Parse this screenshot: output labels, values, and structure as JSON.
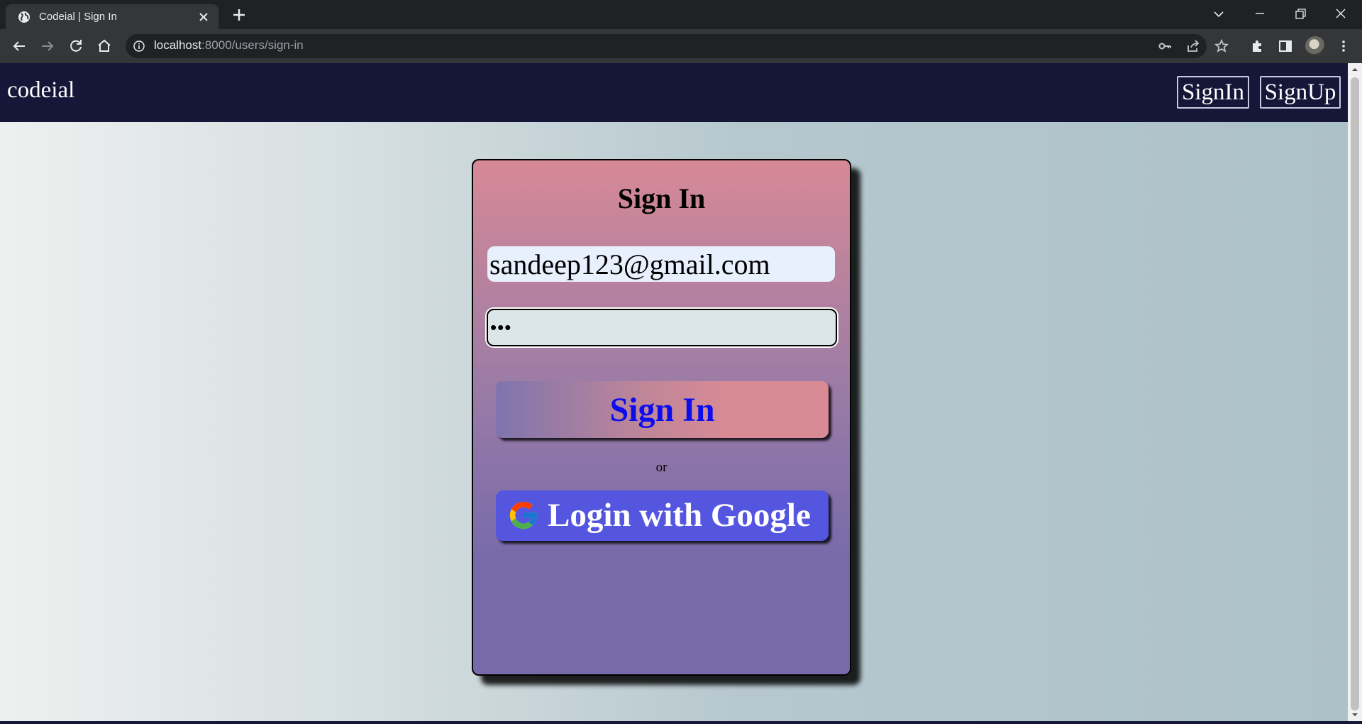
{
  "browser": {
    "tab_title": "Codeial | Sign In",
    "url_host": "localhost",
    "url_path": ":8000/users/sign-in"
  },
  "header": {
    "brand": "codeial",
    "signin_label": "SignIn",
    "signup_label": "SignUp"
  },
  "form": {
    "title": "Sign In",
    "email_value": "sandeep123@gmail.com",
    "password_value": "•••",
    "submit_label": "Sign In",
    "divider_text": "or",
    "google_label": "Login with Google"
  },
  "colors": {
    "header_bg": "#161639",
    "submit_text": "#0b0ded",
    "google_button": "#5556e0"
  }
}
